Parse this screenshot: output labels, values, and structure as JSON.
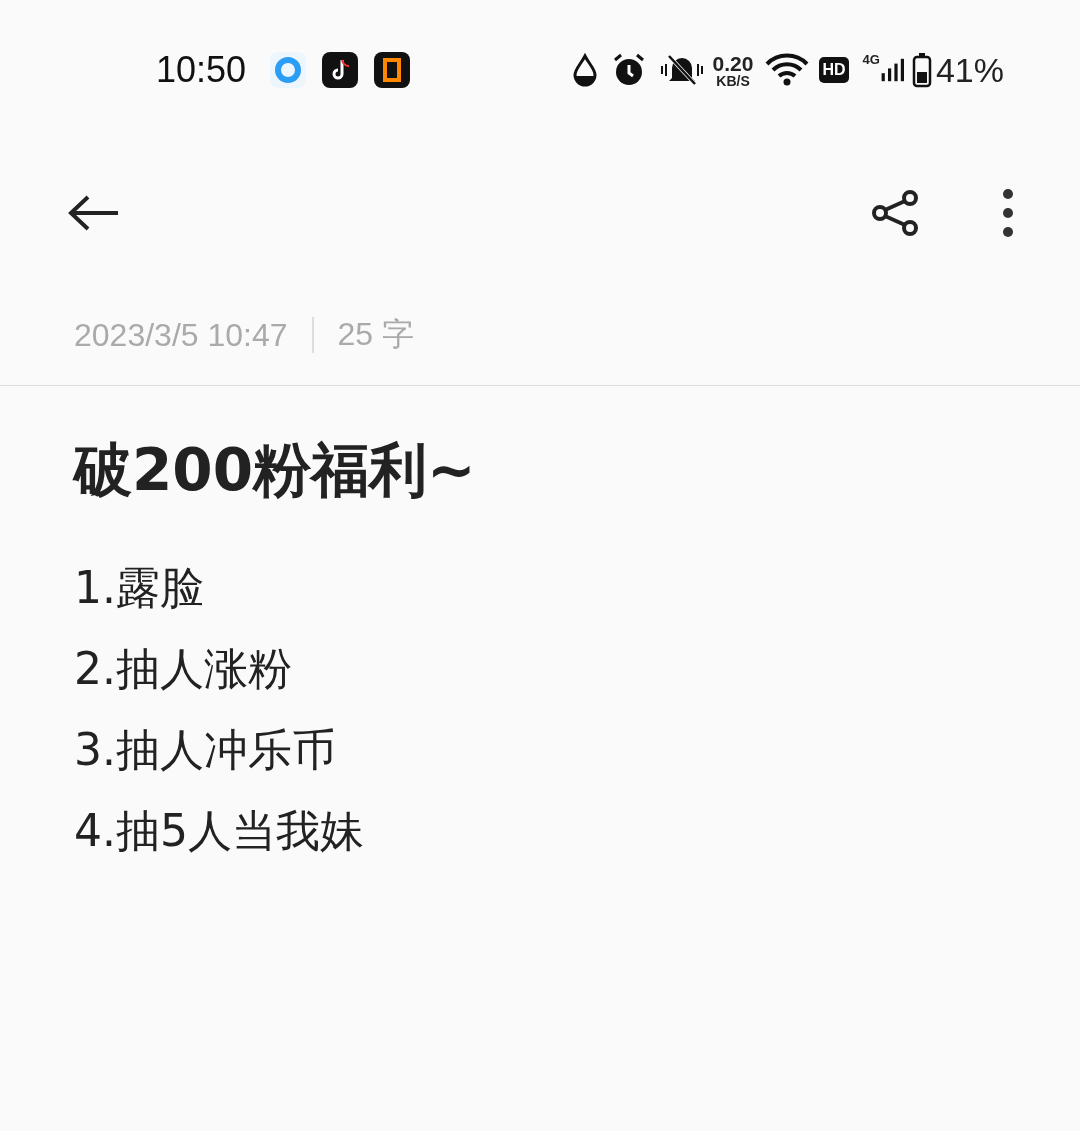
{
  "status_bar": {
    "time": "10:50",
    "net_speed": "0.20",
    "net_unit": "KB/S",
    "hd_badge": "HD",
    "network_type": "4G",
    "battery": "41%"
  },
  "note": {
    "date": "2023/3/5 10:47",
    "word_count": "25 字",
    "title": "破200粉福利~",
    "lines": [
      "1.露脸",
      "2.抽人涨粉",
      "3.抽人冲乐币",
      "4.抽5人当我妹"
    ]
  }
}
